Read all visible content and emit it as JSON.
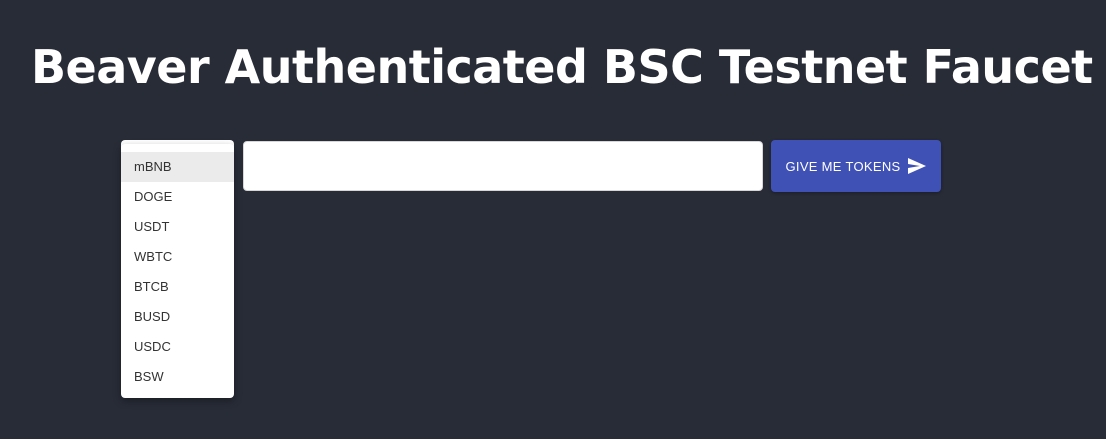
{
  "header": {
    "title": "Beaver Authenticated BSC Testnet Faucet"
  },
  "form": {
    "token_select": {
      "selected_value": "mBNB",
      "options": [
        "mBNB",
        "DOGE",
        "USDT",
        "WBTC",
        "BTCB",
        "BUSD",
        "USDC",
        "BSW"
      ]
    },
    "address_input": {
      "value": "",
      "placeholder": ""
    },
    "submit_button": {
      "label": "GIVE ME TOKENS",
      "icon": "send-icon"
    }
  },
  "colors": {
    "background": "#282c37",
    "accent": "#3f51b5",
    "selected_option_bg": "#ebebeb"
  }
}
